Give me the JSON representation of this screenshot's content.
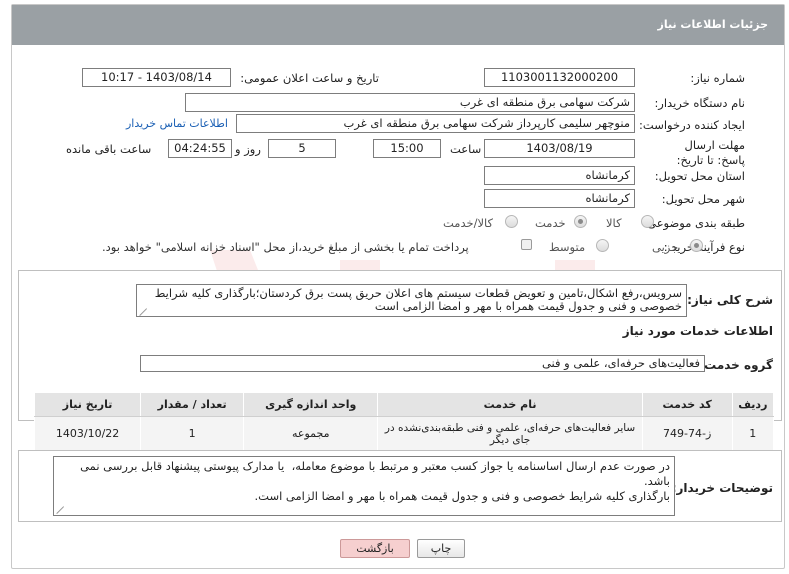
{
  "header": {
    "title": "جزئیات اطلاعات نیاز"
  },
  "form": {
    "need_number": {
      "label": "شماره نیاز:",
      "value": "1103001132000200"
    },
    "announce_datetime": {
      "label": "تاریخ و ساعت اعلان عمومی:",
      "value": "1403/08/14 - 10:17"
    },
    "buyer_org": {
      "label": "نام دستگاه خریدار:",
      "value": "شرکت سهامی برق منطقه ای غرب"
    },
    "requester": {
      "label": "ایجاد کننده درخواست:",
      "value": "منوچهر  سلیمی کارپرداز شرکت سهامی برق منطقه ای غرب",
      "link": "اطلاعات تماس خریدار"
    },
    "deadline": {
      "label": "مهلت ارسال پاسخ: تا تاریخ:",
      "date": "1403/08/19",
      "time_label": "ساعت",
      "time": "15:00",
      "days": "5",
      "days_label": "روز و",
      "remaining": "04:24:55",
      "remaining_label": "ساعت باقی مانده"
    },
    "province": {
      "label": "استان محل تحویل:",
      "value": "کرمانشاه"
    },
    "city": {
      "label": "شهر محل تحویل:",
      "value": "کرمانشاه"
    },
    "category": {
      "label": "طبقه بندی موضوعی:",
      "options": [
        "کالا",
        "خدمت",
        "کالا/خدمت"
      ],
      "selected": "خدمت"
    },
    "process_type": {
      "label": "نوع فرآیند خرید :",
      "options": [
        "جزیی",
        "متوسط"
      ],
      "selected": "جزیی",
      "payment_note": "پرداخت تمام یا بخشی از مبلغ خرید،از محل \"اسناد خزانه اسلامی\" خواهد بود."
    }
  },
  "description": {
    "label": "شرح کلی نیاز:",
    "text": "سرویس،رفع اشکال،تامین و تعویض قطعات سیستم های اعلان حریق پست برق کردستان؛بارگذاری کلیه شرایط خصوصی و فنی و جدول قیمت همراه با مهر و امضا الزامی است"
  },
  "services": {
    "title": "اطلاعات خدمات مورد نیاز",
    "group_label": "گروه خدمت:",
    "group_value": "فعالیت‌های حرفه‌ای، علمی و فنی",
    "table": {
      "headers": [
        "ردیف",
        "کد خدمت",
        "نام خدمت",
        "واحد اندازه گیری",
        "تعداد / مقدار",
        "تاریخ نیاز"
      ],
      "rows": [
        [
          "1",
          "ز-74-749",
          "سایر فعالیت‌های حرفه‌ای، علمی و فنی طبقه‌بندی‌نشده در جای دیگر",
          "مجموعه",
          "1",
          "1403/10/22"
        ]
      ]
    }
  },
  "buyer_notes": {
    "label": "توضیحات خریدار:",
    "text": "در صورت عدم ارسال اساسنامه یا جواز کسب معتبر و مرتبط با موضوع معامله،  یا مدارک پیوستی پیشنهاد قابل بررسی نمی باشد.\nبارگذاری کلیه شرایط خصوصی و فنی و جدول قیمت همراه با مهر و امضا الزامی است."
  },
  "buttons": {
    "print": "چاپ",
    "back": "بازگشت"
  },
  "colors": {
    "header_bg": "#9aa0a4",
    "link": "#1a5fb4",
    "back_button": "#f6cfcf"
  }
}
